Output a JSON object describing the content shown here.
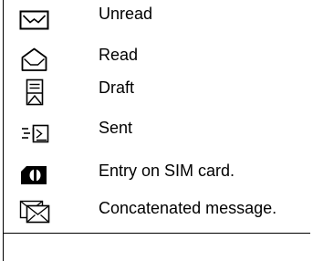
{
  "legend": {
    "items": [
      {
        "icon": "unread-envelope-icon",
        "label": "Unread"
      },
      {
        "icon": "read-envelope-icon",
        "label": "Read"
      },
      {
        "icon": "draft-message-icon",
        "label": "Draft"
      },
      {
        "icon": "sent-message-icon",
        "label": "Sent"
      },
      {
        "icon": "sim-card-entry-icon",
        "label": "Entry on SIM card."
      },
      {
        "icon": "concatenated-message-icon",
        "label": "Concatenated message."
      }
    ]
  },
  "colors": {
    "text": "#000000",
    "icon_stroke": "#000000",
    "icon_fill": "#000000",
    "background": "#ffffff"
  }
}
